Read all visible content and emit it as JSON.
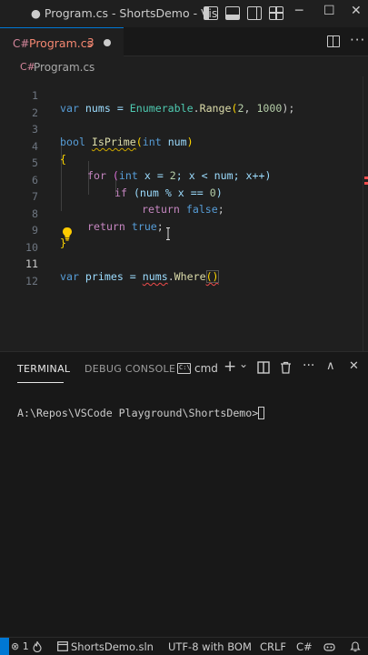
{
  "window": {
    "title": "● Program.cs - ShortsDemo - Vis",
    "controls": {
      "minimize": "─",
      "maximize": "☐",
      "close": "✕"
    }
  },
  "tab": {
    "icon": "C#",
    "name": "Program.cs",
    "problem_count": "3"
  },
  "breadcrumb": {
    "icon": "C#",
    "file": "Program.cs"
  },
  "editor": {
    "lines": [
      {
        "n": "1"
      },
      {
        "n": "2"
      },
      {
        "n": "3"
      },
      {
        "n": "4"
      },
      {
        "n": "5"
      },
      {
        "n": "6"
      },
      {
        "n": "7"
      },
      {
        "n": "8"
      },
      {
        "n": "9"
      },
      {
        "n": "10"
      },
      {
        "n": "11"
      },
      {
        "n": "12"
      }
    ],
    "code": {
      "l1_kw": "var",
      "l1_name": " nums = ",
      "l1_type": "Enumerable",
      "l1_dot": ".",
      "l1_fn": "Range",
      "l1_open": "(",
      "l1_n1": "2",
      "l1_comma": ", ",
      "l1_n2": "1000",
      "l1_close": ");",
      "l3_kw": "bool",
      "l3_fn": "IsPrime",
      "l3_open": "(",
      "l3_kw2": "int",
      "l3_param": " num",
      "l3_close": ")",
      "l4_brace": "{",
      "l5_for": "for",
      "l5_open": " (",
      "l5_int": "int",
      "l5_rest1": " x = ",
      "l5_n": "2",
      "l5_rest2": "; x < num; x++)",
      "l6_if": "if",
      "l6_rest1": " (num % x == ",
      "l6_n": "0",
      "l6_rest2": ")",
      "l7_return": "return",
      "l7_false": " false",
      "l7_semi": ";",
      "l8_return": "return",
      "l8_true": " true",
      "l8_semi": ";",
      "l9_brace": "}",
      "l11_kw": "var",
      "l11_name": " primes = ",
      "l11_obj": "nums",
      "l11_dot": ".",
      "l11_fn": "Where",
      "l11_parens": "()"
    }
  },
  "panel": {
    "tabs": {
      "terminal": "TERMINAL",
      "debug_console": "DEBUG CONSOLE"
    },
    "shell": "cmd",
    "icons": {
      "add": "+",
      "dropdown": "⌄",
      "split": "split-icon",
      "trash": "trash-icon",
      "more": "···",
      "maximize": "∧",
      "close": "✕"
    },
    "prompt": "A:\\Repos\\VSCode Playground\\ShortsDemo>"
  },
  "statusbar": {
    "problems": "⊗ 1",
    "branch_icon": "flame-icon",
    "solution": "ShortsDemo.sln",
    "encoding": "UTF-8 with BOM",
    "eol": "CRLF",
    "language": "C#"
  },
  "colors": {
    "background": "#1f1f1f",
    "accent": "#0078d4",
    "error": "#f14c4c",
    "warning": "#cca700"
  }
}
